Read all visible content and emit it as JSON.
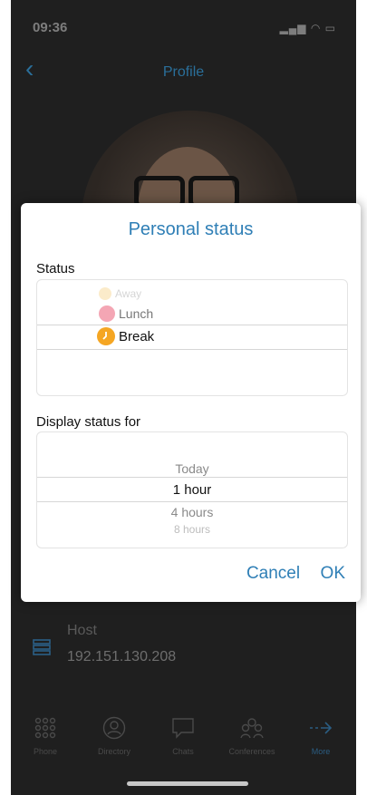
{
  "statusbar": {
    "time": "09:36"
  },
  "header": {
    "title": "Profile"
  },
  "profile": {
    "host_label": "Host",
    "host_value": "192.151.130.208"
  },
  "tabs": [
    {
      "label": "Phone",
      "icon": "grid-icon"
    },
    {
      "label": "Directory",
      "icon": "contact-icon"
    },
    {
      "label": "Chats",
      "icon": "chat-icon"
    },
    {
      "label": "Conferences",
      "icon": "group-icon"
    },
    {
      "label": "More",
      "icon": "arrow-right-icon"
    }
  ],
  "dialog": {
    "title": "Personal status",
    "status_label": "Status",
    "status_options": [
      {
        "label": "Away",
        "color": "#f5c86b"
      },
      {
        "label": "Lunch",
        "color": "#f07a8c"
      },
      {
        "label": "Break",
        "color": "#f5a623"
      }
    ],
    "selected_status": "Break",
    "display_label": "Display status for",
    "duration_options": [
      "Today",
      "1 hour",
      "4 hours",
      "8 hours"
    ],
    "selected_duration": "1 hour",
    "cancel_label": "Cancel",
    "ok_label": "OK"
  },
  "colors": {
    "accent": "#2f7fb6",
    "background": "#1f1f1f"
  }
}
